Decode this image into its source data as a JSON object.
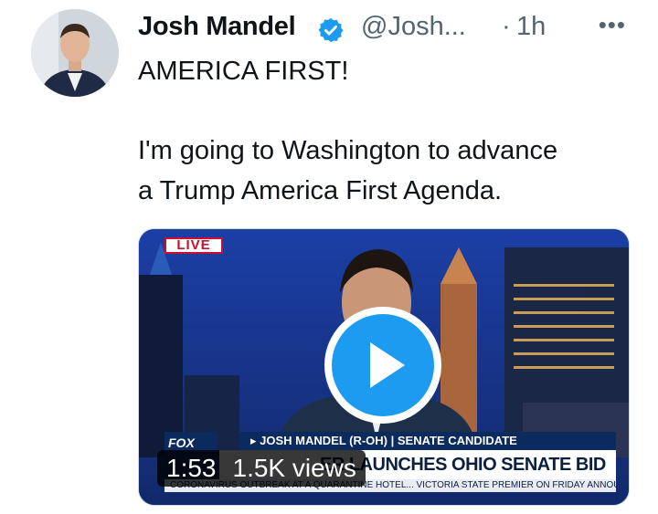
{
  "tweet": {
    "author_name": "Josh Mandel",
    "handle": "@Josh...",
    "separator": "·",
    "time": "1h",
    "more_label": "•••",
    "lines": [
      "AMERICA FIRST!",
      "I'm going to Washington to advance",
      "a Trump America First Agenda."
    ]
  },
  "video": {
    "live_badge": "LIVE",
    "chyron_top": "▸ JOSH MANDEL (R-OH) | SENATE CANDIDATE",
    "chyron_main": "ER LAUNCHES OHIO SENATE BID",
    "chyron_ticker": "CORONAVIRUS OUTBREAK AT A QUARANTINE HOTEL...  VICTORIA STATE PREMIER ON FRIDAY ANNOUNC",
    "network_logo": "FOX",
    "duration": "1:53",
    "views": "1.5K views"
  },
  "colors": {
    "accent": "#1d9bf0",
    "secondary_text": "#536471",
    "primary_text": "#0f1419",
    "live_red": "#c8102e"
  }
}
